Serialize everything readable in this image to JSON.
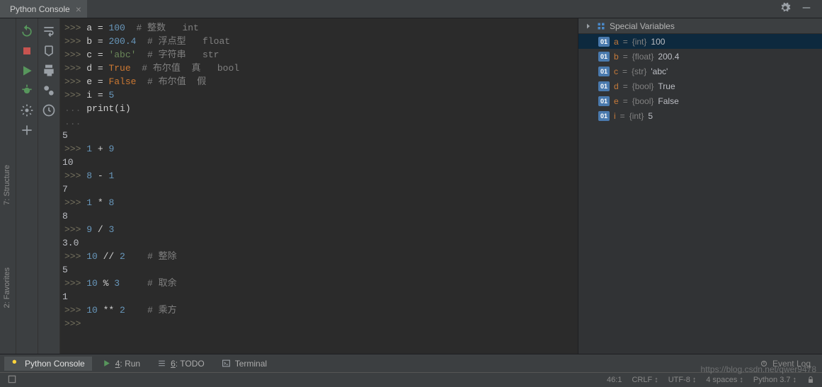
{
  "tab": {
    "title": "Python Console"
  },
  "sidebar": {
    "structure": "7: Structure",
    "favorites": "2: Favorites"
  },
  "console": {
    "lines": [
      {
        "type": "in",
        "tokens": [
          [
            "var",
            "a"
          ],
          [
            "op",
            " = "
          ],
          [
            "num",
            "100"
          ],
          [
            "comment",
            "  # 整数   int"
          ]
        ]
      },
      {
        "type": "in",
        "tokens": [
          [
            "var",
            "b"
          ],
          [
            "op",
            " = "
          ],
          [
            "num",
            "200.4"
          ],
          [
            "comment",
            "  # 浮点型   float"
          ]
        ]
      },
      {
        "type": "in",
        "tokens": [
          [
            "var",
            "c"
          ],
          [
            "op",
            " = "
          ],
          [
            "str",
            "'abc'"
          ],
          [
            "comment",
            "  # 字符串   str"
          ]
        ]
      },
      {
        "type": "in",
        "tokens": [
          [
            "var",
            "d"
          ],
          [
            "op",
            " = "
          ],
          [
            "kw",
            "True"
          ],
          [
            "comment",
            "  # 布尔值  真   bool"
          ]
        ]
      },
      {
        "type": "in",
        "tokens": [
          [
            "var",
            "e"
          ],
          [
            "op",
            " = "
          ],
          [
            "kw",
            "False"
          ],
          [
            "comment",
            "  # 布尔值  假"
          ]
        ]
      },
      {
        "type": "in",
        "tokens": [
          [
            "var",
            "i"
          ],
          [
            "op",
            " = "
          ],
          [
            "num",
            "5"
          ]
        ]
      },
      {
        "type": "cont",
        "tokens": [
          [
            "var",
            "print(i)"
          ]
        ]
      },
      {
        "type": "cont",
        "tokens": []
      },
      {
        "type": "out",
        "text": "5"
      },
      {
        "type": "in",
        "tokens": [
          [
            "num",
            "1"
          ],
          [
            "op",
            " + "
          ],
          [
            "num",
            "9"
          ]
        ]
      },
      {
        "type": "out",
        "text": "10"
      },
      {
        "type": "in",
        "tokens": [
          [
            "num",
            "8"
          ],
          [
            "op",
            " - "
          ],
          [
            "num",
            "1"
          ]
        ]
      },
      {
        "type": "out",
        "text": "7"
      },
      {
        "type": "in",
        "tokens": [
          [
            "num",
            "1"
          ],
          [
            "op",
            " * "
          ],
          [
            "num",
            "8"
          ]
        ]
      },
      {
        "type": "out",
        "text": "8"
      },
      {
        "type": "in",
        "tokens": [
          [
            "num",
            "9"
          ],
          [
            "op",
            " / "
          ],
          [
            "num",
            "3"
          ]
        ]
      },
      {
        "type": "out",
        "text": "3.0"
      },
      {
        "type": "in",
        "tokens": [
          [
            "num",
            "10"
          ],
          [
            "op",
            " // "
          ],
          [
            "num",
            "2"
          ],
          [
            "comment",
            "    # 整除"
          ]
        ]
      },
      {
        "type": "out",
        "text": "5"
      },
      {
        "type": "in",
        "tokens": [
          [
            "num",
            "10"
          ],
          [
            "op",
            " % "
          ],
          [
            "num",
            "3"
          ],
          [
            "comment",
            "     # 取余"
          ]
        ]
      },
      {
        "type": "out",
        "text": "1"
      },
      {
        "type": "in",
        "tokens": [
          [
            "num",
            "10"
          ],
          [
            "op",
            " ** "
          ],
          [
            "num",
            "2"
          ],
          [
            "comment",
            "    # 乘方"
          ]
        ]
      },
      {
        "type": "in",
        "tokens": []
      }
    ]
  },
  "variables": {
    "header": "Special Variables",
    "items": [
      {
        "name": "a",
        "type": "{int}",
        "value": "100",
        "selected": true
      },
      {
        "name": "b",
        "type": "{float}",
        "value": "200.4",
        "selected": false
      },
      {
        "name": "c",
        "type": "{str}",
        "value": "'abc'",
        "selected": false
      },
      {
        "name": "d",
        "type": "{bool}",
        "value": "True",
        "selected": false
      },
      {
        "name": "e",
        "type": "{bool}",
        "value": "False",
        "selected": false
      },
      {
        "name": "i",
        "type": "{int}",
        "value": "5",
        "selected": false
      }
    ]
  },
  "bottom": {
    "python_console": "Python Console",
    "run": "4: Run",
    "todo": "6: TODO",
    "terminal": "Terminal",
    "event_log": "Event Log"
  },
  "status": {
    "pos": "46:1",
    "line_sep": "CRLF",
    "encoding": "UTF-8",
    "indent": "4 spaces",
    "interpreter": "Python 3.7"
  },
  "watermark": "https://blog.csdn.net/qwer9478"
}
